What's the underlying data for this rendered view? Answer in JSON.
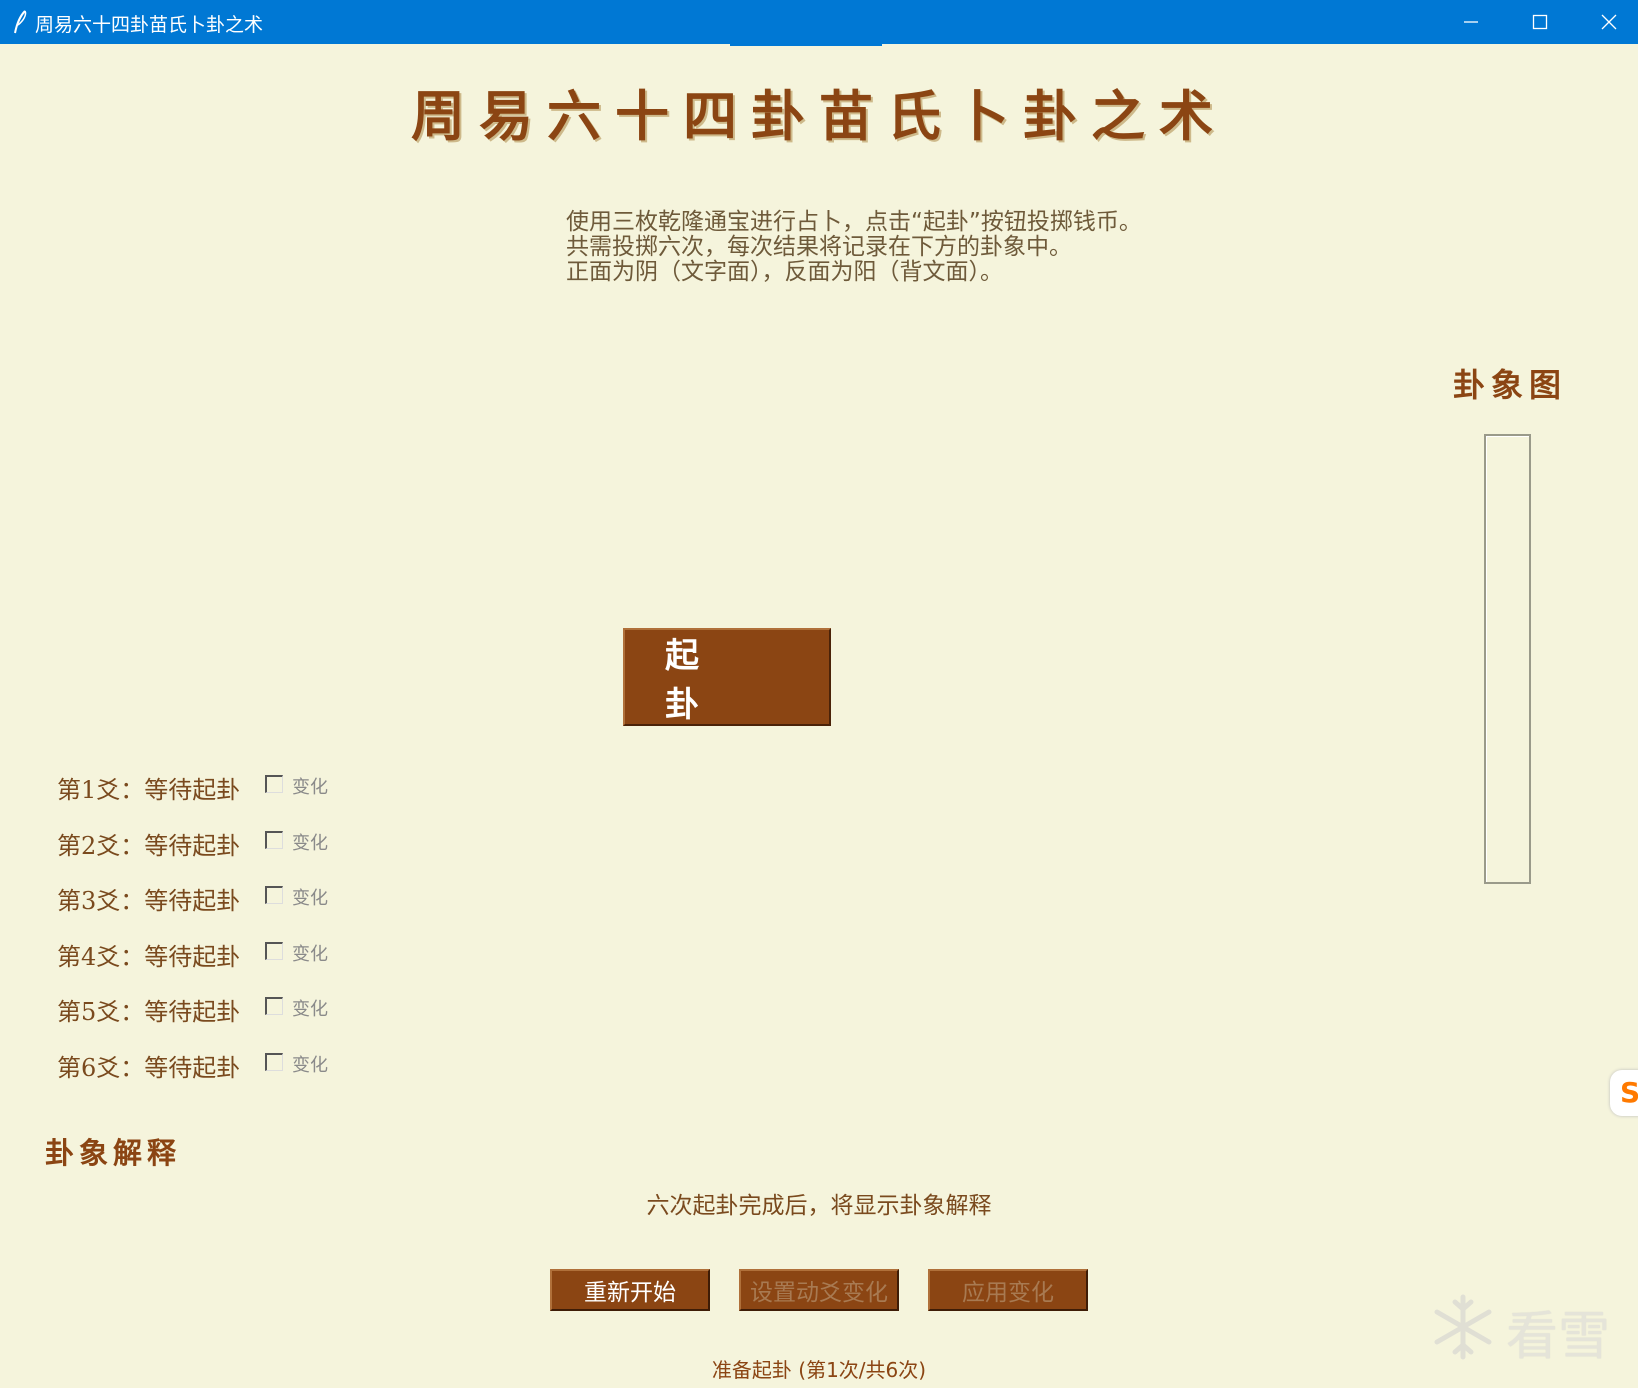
{
  "window": {
    "title": "周易六十四卦苗氏卜卦之术",
    "icon": "feather-pen-icon",
    "controls": [
      "minimize-icon",
      "maximize-icon",
      "close-icon"
    ]
  },
  "main_title": "周易六十四卦苗氏卜卦之术",
  "instructions": [
    "使用三枚乾隆通宝进行占卜，点击“起卦”按钮投掷钱币。",
    "共需投掷六次，每次结果将记录在下方的卦象中。",
    "正面为阴（文字面），反面为阳（背文面）。"
  ],
  "hexagram_panel": {
    "title": "卦象图"
  },
  "cast_button": "起 卦",
  "yao_lines": [
    {
      "label": "第1爻：等待起卦",
      "checkbox_label": "变化",
      "checked": false
    },
    {
      "label": "第2爻：等待起卦",
      "checkbox_label": "变化",
      "checked": false
    },
    {
      "label": "第3爻：等待起卦",
      "checkbox_label": "变化",
      "checked": false
    },
    {
      "label": "第4爻：等待起卦",
      "checkbox_label": "变化",
      "checked": false
    },
    {
      "label": "第5爻：等待起卦",
      "checkbox_label": "变化",
      "checked": false
    },
    {
      "label": "第6爻：等待起卦",
      "checkbox_label": "变化",
      "checked": false
    }
  ],
  "interpretation": {
    "title": "卦象解释",
    "text": "六次起卦完成后，将显示卦象解释"
  },
  "actions": {
    "restart": "重新开始",
    "set_changing": "设置动爻变化",
    "apply_changes": "应用变化"
  },
  "status": "准备起卦 (第1次/共6次)",
  "watermark": {
    "text": "看雪",
    "icon": "snowflake-icon"
  },
  "side_tab": {
    "text": "S"
  },
  "colors": {
    "titlebar": "#0078d4",
    "background": "#f5f4dc",
    "accent_brown": "#8b4513",
    "disabled_text": "#a87a52"
  }
}
